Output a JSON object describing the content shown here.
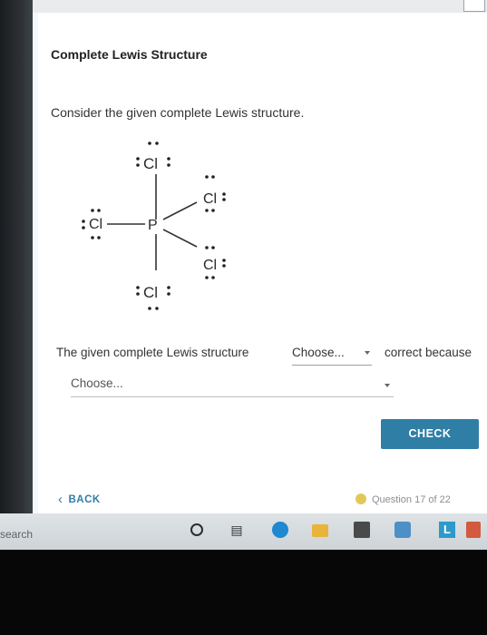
{
  "title": "Complete Lewis Structure",
  "prompt": "Consider the given complete Lewis structure.",
  "structure": {
    "atoms": {
      "top": "Cl",
      "left": "Cl",
      "center": "P",
      "upper_right": "Cl",
      "lower_right": "Cl",
      "bottom": "Cl"
    }
  },
  "question": {
    "sentence_start": "The given complete Lewis structure",
    "dropdown1_value": "Choose...",
    "sentence_end": "correct because",
    "dropdown2_value": "Choose..."
  },
  "buttons": {
    "check": "CHECK",
    "back": "BACK"
  },
  "progress": "Question 17 of 22",
  "taskbar": {
    "search": "search",
    "icons": [
      "cortana-icon",
      "task-view-icon",
      "edge-browser-icon",
      "file-explorer-icon",
      "store-icon",
      "mail-icon",
      "l-app-icon",
      "s-app-icon"
    ]
  },
  "colors": {
    "accent": "#2f7ea6",
    "progress_dot": "#e2c85a"
  }
}
